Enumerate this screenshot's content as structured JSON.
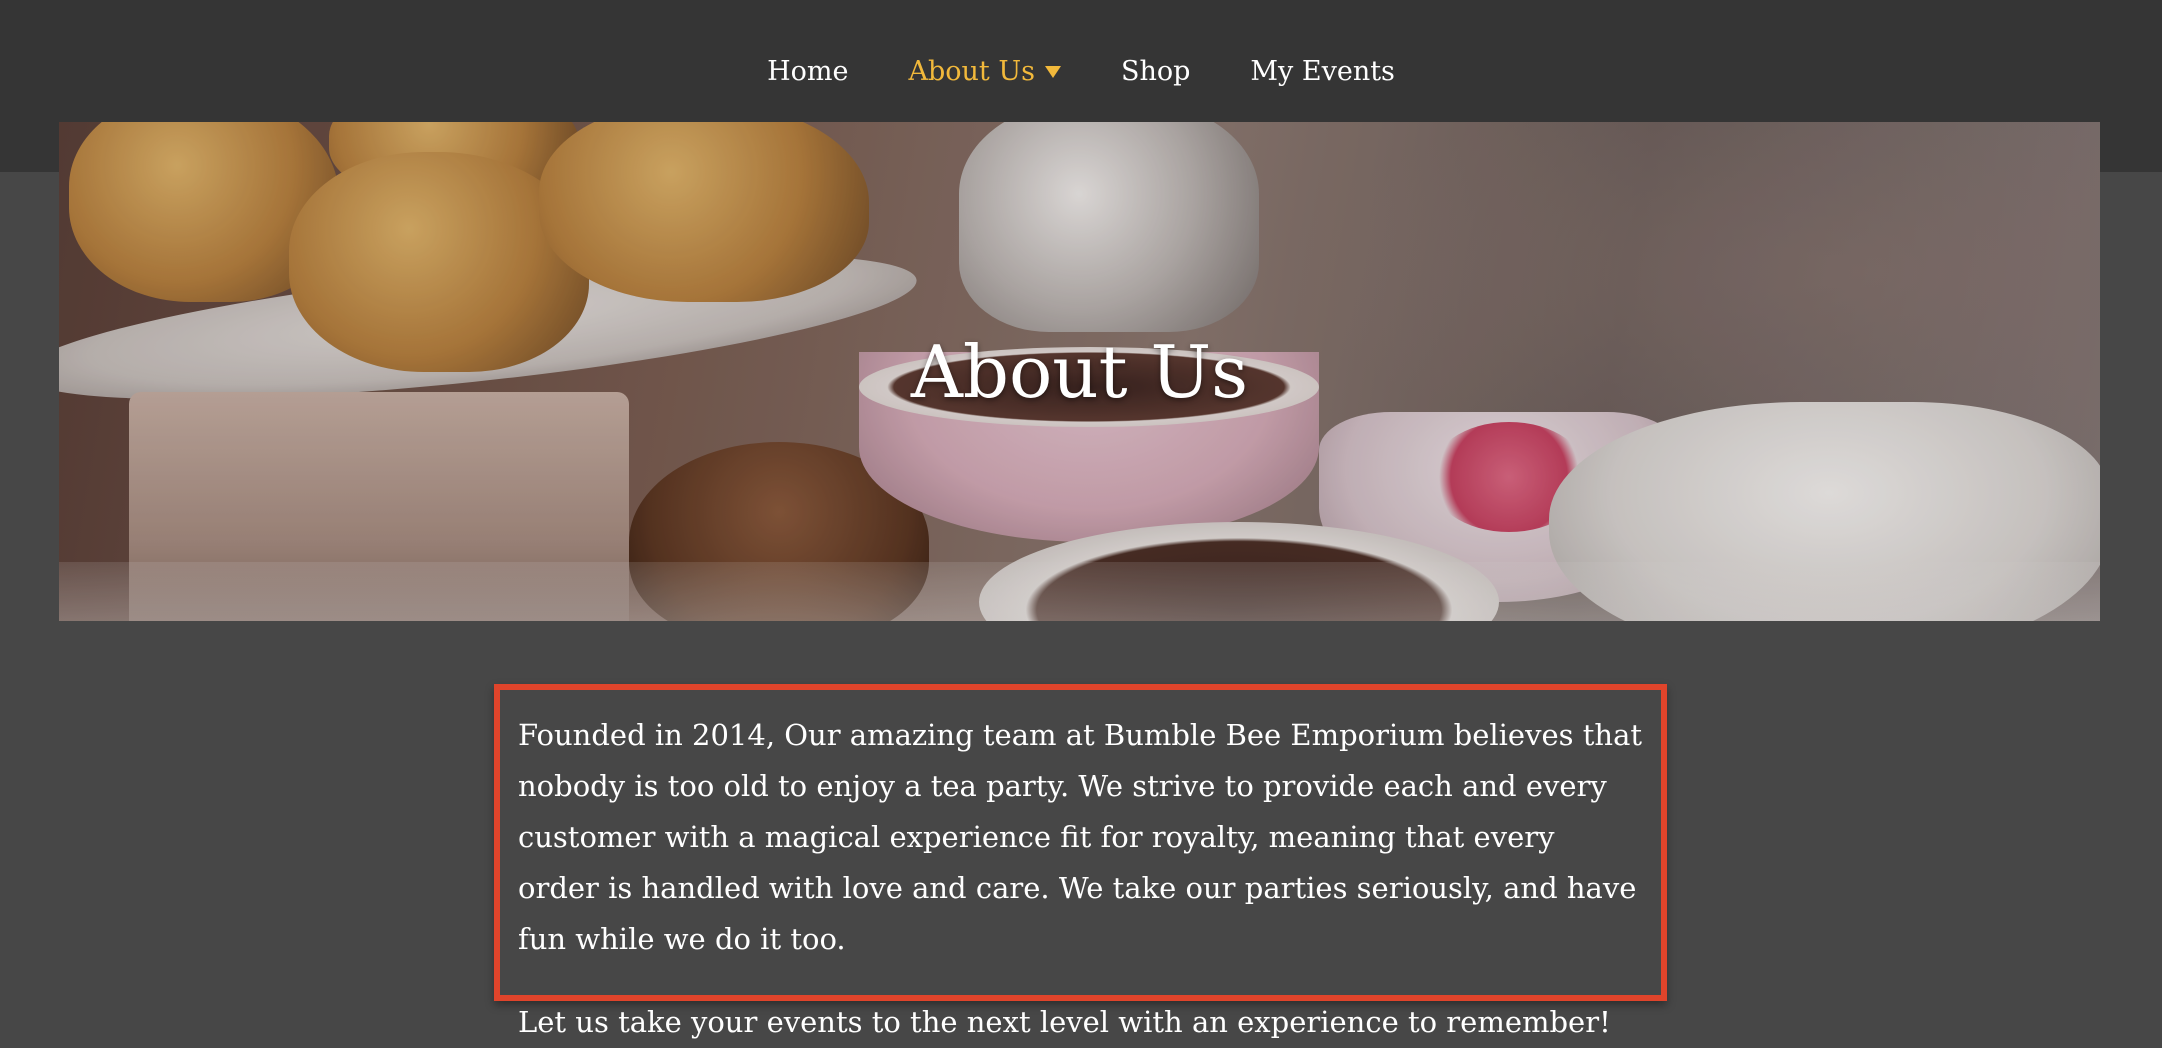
{
  "nav": {
    "items": [
      {
        "label": "Home",
        "active": false
      },
      {
        "label": "About Us",
        "active": true,
        "has_dropdown": true
      },
      {
        "label": "Shop",
        "active": false
      },
      {
        "label": "My Events",
        "active": false
      }
    ],
    "active_color": "#f2b93b"
  },
  "hero": {
    "title": "About Us",
    "image_description_icon": "afternoon-tea-photo"
  },
  "about": {
    "paragraph_1": "Founded in 2014, Our amazing team at Bumble Bee Emporium believes that nobody is too old to enjoy a tea party. We strive to provide each and every customer with a magical experience fit for royalty, meaning that every order is handled with love and care. We take our parties seriously, and have fun while we do it too.",
    "paragraph_2": "Let us take your events to the next level with an experience to remember!",
    "highlight_color": "#e0442b"
  }
}
